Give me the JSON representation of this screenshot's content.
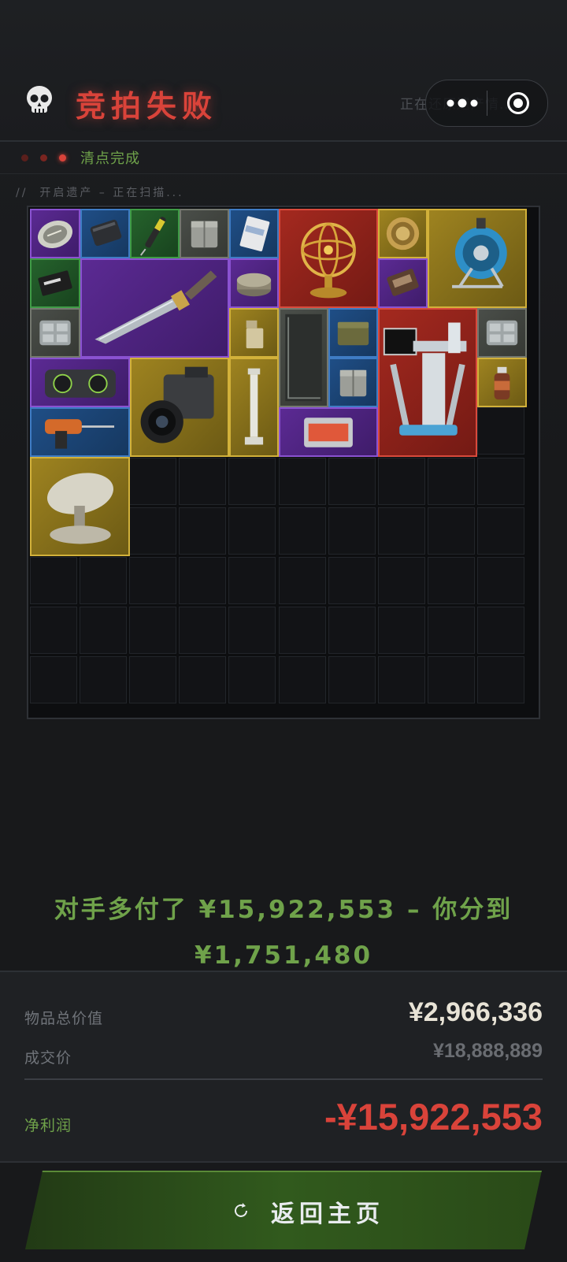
{
  "header": {
    "title": "竞拍失败",
    "skull_icon": "skull-icon",
    "right_text": "正在还原遗产情..."
  },
  "status": {
    "text": "清点完成",
    "dot_colors": [
      "#5a1f1c",
      "#7a2520",
      "#d9433a"
    ]
  },
  "log": "//  开启遗产 – 正在扫描...",
  "inventory": {
    "columns": 10,
    "rows": 10,
    "items": [
      {
        "name": "pocket-watch-item",
        "rarity": "purple"
      },
      {
        "name": "power-bank-item",
        "rarity": "blue"
      },
      {
        "name": "voltage-tester-item",
        "rarity": "green"
      },
      {
        "name": "ammo-case-item",
        "rarity": "gray"
      },
      {
        "name": "card-pack-item",
        "rarity": "blue"
      },
      {
        "name": "armillary-sphere-item",
        "rarity": "red"
      },
      {
        "name": "coin-tin-item",
        "rarity": "gold"
      },
      {
        "name": "cable-reel-item",
        "rarity": "gold"
      },
      {
        "name": "good-luck-card-item",
        "rarity": "green"
      },
      {
        "name": "hunting-knife-item",
        "rarity": "purple"
      },
      {
        "name": "tin-box-item",
        "rarity": "purple"
      },
      {
        "name": "cassette-tape-item",
        "rarity": "purple"
      },
      {
        "name": "tool-tray-item",
        "rarity": "gray"
      },
      {
        "name": "lighter-item",
        "rarity": "gold"
      },
      {
        "name": "dark-panel-item",
        "rarity": "gray"
      },
      {
        "name": "ration-can-item",
        "rarity": "blue"
      },
      {
        "name": "robot-station-item",
        "rarity": "red"
      },
      {
        "name": "tool-tray-2-item",
        "rarity": "gray"
      },
      {
        "name": "speaker-item",
        "rarity": "purple"
      },
      {
        "name": "camera-item",
        "rarity": "gold"
      },
      {
        "name": "column-item",
        "rarity": "gold"
      },
      {
        "name": "ammo-case-2-item",
        "rarity": "blue"
      },
      {
        "name": "bottle-item",
        "rarity": "gold"
      },
      {
        "name": "drill-item",
        "rarity": "blue"
      },
      {
        "name": "circuit-board-item",
        "rarity": "purple"
      },
      {
        "name": "satellite-dish-item",
        "rarity": "gold"
      }
    ]
  },
  "summary": {
    "line1": "对手多付了 ¥15,922,553 – 你分到",
    "line2": "¥1,751,480"
  },
  "stats": {
    "total_label": "物品总价值",
    "total_value": "¥2,966,336",
    "deal_label": "成交价",
    "deal_value": "¥18,888,889",
    "profit_label": "净利润",
    "profit_value": "-¥15,922,553"
  },
  "colors": {
    "accent_red": "#d9433a",
    "accent_green": "#6fa24a"
  },
  "button": {
    "label": "返回主页",
    "icon": "refresh-icon"
  },
  "capsule": {
    "more_icon": "more-dots-icon",
    "close_icon": "target-close-icon"
  }
}
